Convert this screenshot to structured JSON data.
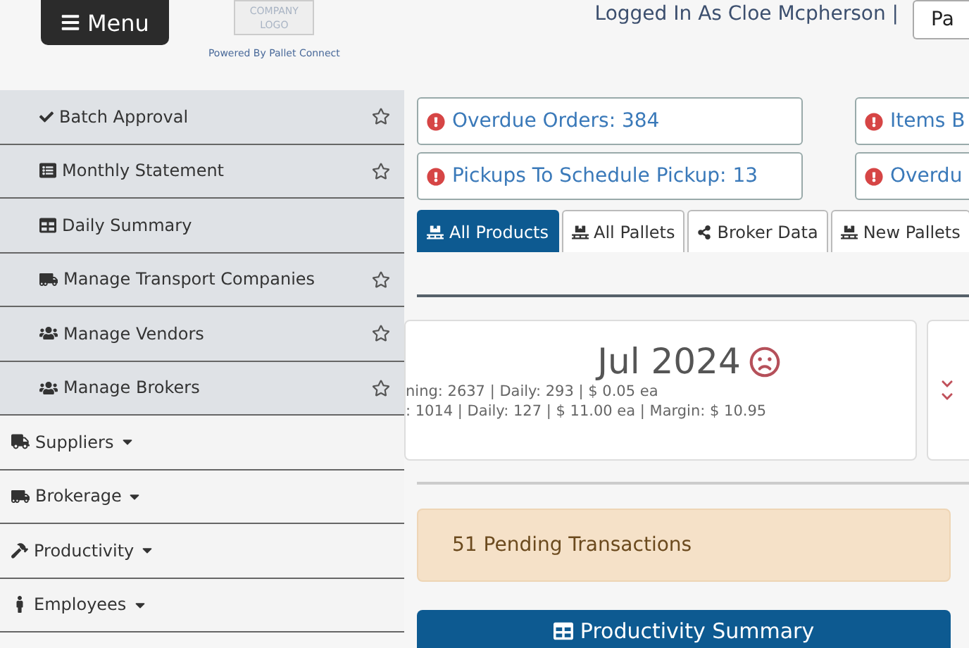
{
  "header": {
    "menu_button": "Menu",
    "logo_text": "COMPANY LOGO",
    "powered_by": "Powered By Pallet Connect",
    "user": "Logged In As Cloe Mcpherson |",
    "user_button": "Pa"
  },
  "sidebar": {
    "subitems": [
      {
        "label": "Batch Approval",
        "kind": "check",
        "star": true
      },
      {
        "label": "Monthly Statement",
        "kind": "statement",
        "star": true
      },
      {
        "label": "Daily Summary",
        "kind": "table",
        "star": false
      },
      {
        "label": "Manage Transport Companies",
        "kind": "truck",
        "star": true
      },
      {
        "label": "Manage Vendors",
        "kind": "users",
        "star": true
      },
      {
        "label": "Manage Brokers",
        "kind": "users",
        "star": true
      }
    ],
    "items": [
      {
        "label": "Suppliers",
        "kind": "supplier"
      },
      {
        "label": "Brokerage",
        "kind": "truck"
      },
      {
        "label": "Productivity",
        "kind": "hammer"
      },
      {
        "label": "Employees",
        "kind": "person"
      }
    ]
  },
  "alerts": [
    [
      {
        "label": "Overdue Orders: 384"
      },
      {
        "label": "Items B"
      }
    ],
    [
      {
        "label": "Pickups To Schedule Pickup: 13"
      },
      {
        "label": "Overdu"
      }
    ]
  ],
  "tabs": [
    {
      "label": "All Products",
      "kind": "pallet",
      "selected": true
    },
    {
      "label": "All Pallets",
      "kind": "pallet",
      "selected": false
    },
    {
      "label": "Broker Data",
      "kind": "share",
      "selected": false
    },
    {
      "label": "New Pallets",
      "kind": "pallet",
      "selected": false
    }
  ],
  "month_card": {
    "title": "Jul 2024",
    "frown": true,
    "lines": [
      "ning: 2637 | Daily: 293 | $ 0.05 ea",
      ": 1014 | Daily: 127 | $ 11.00 ea | Margin: $ 10.95"
    ]
  },
  "pending": "51 Pending Transactions",
  "summary_button": "Productivity Summary"
}
